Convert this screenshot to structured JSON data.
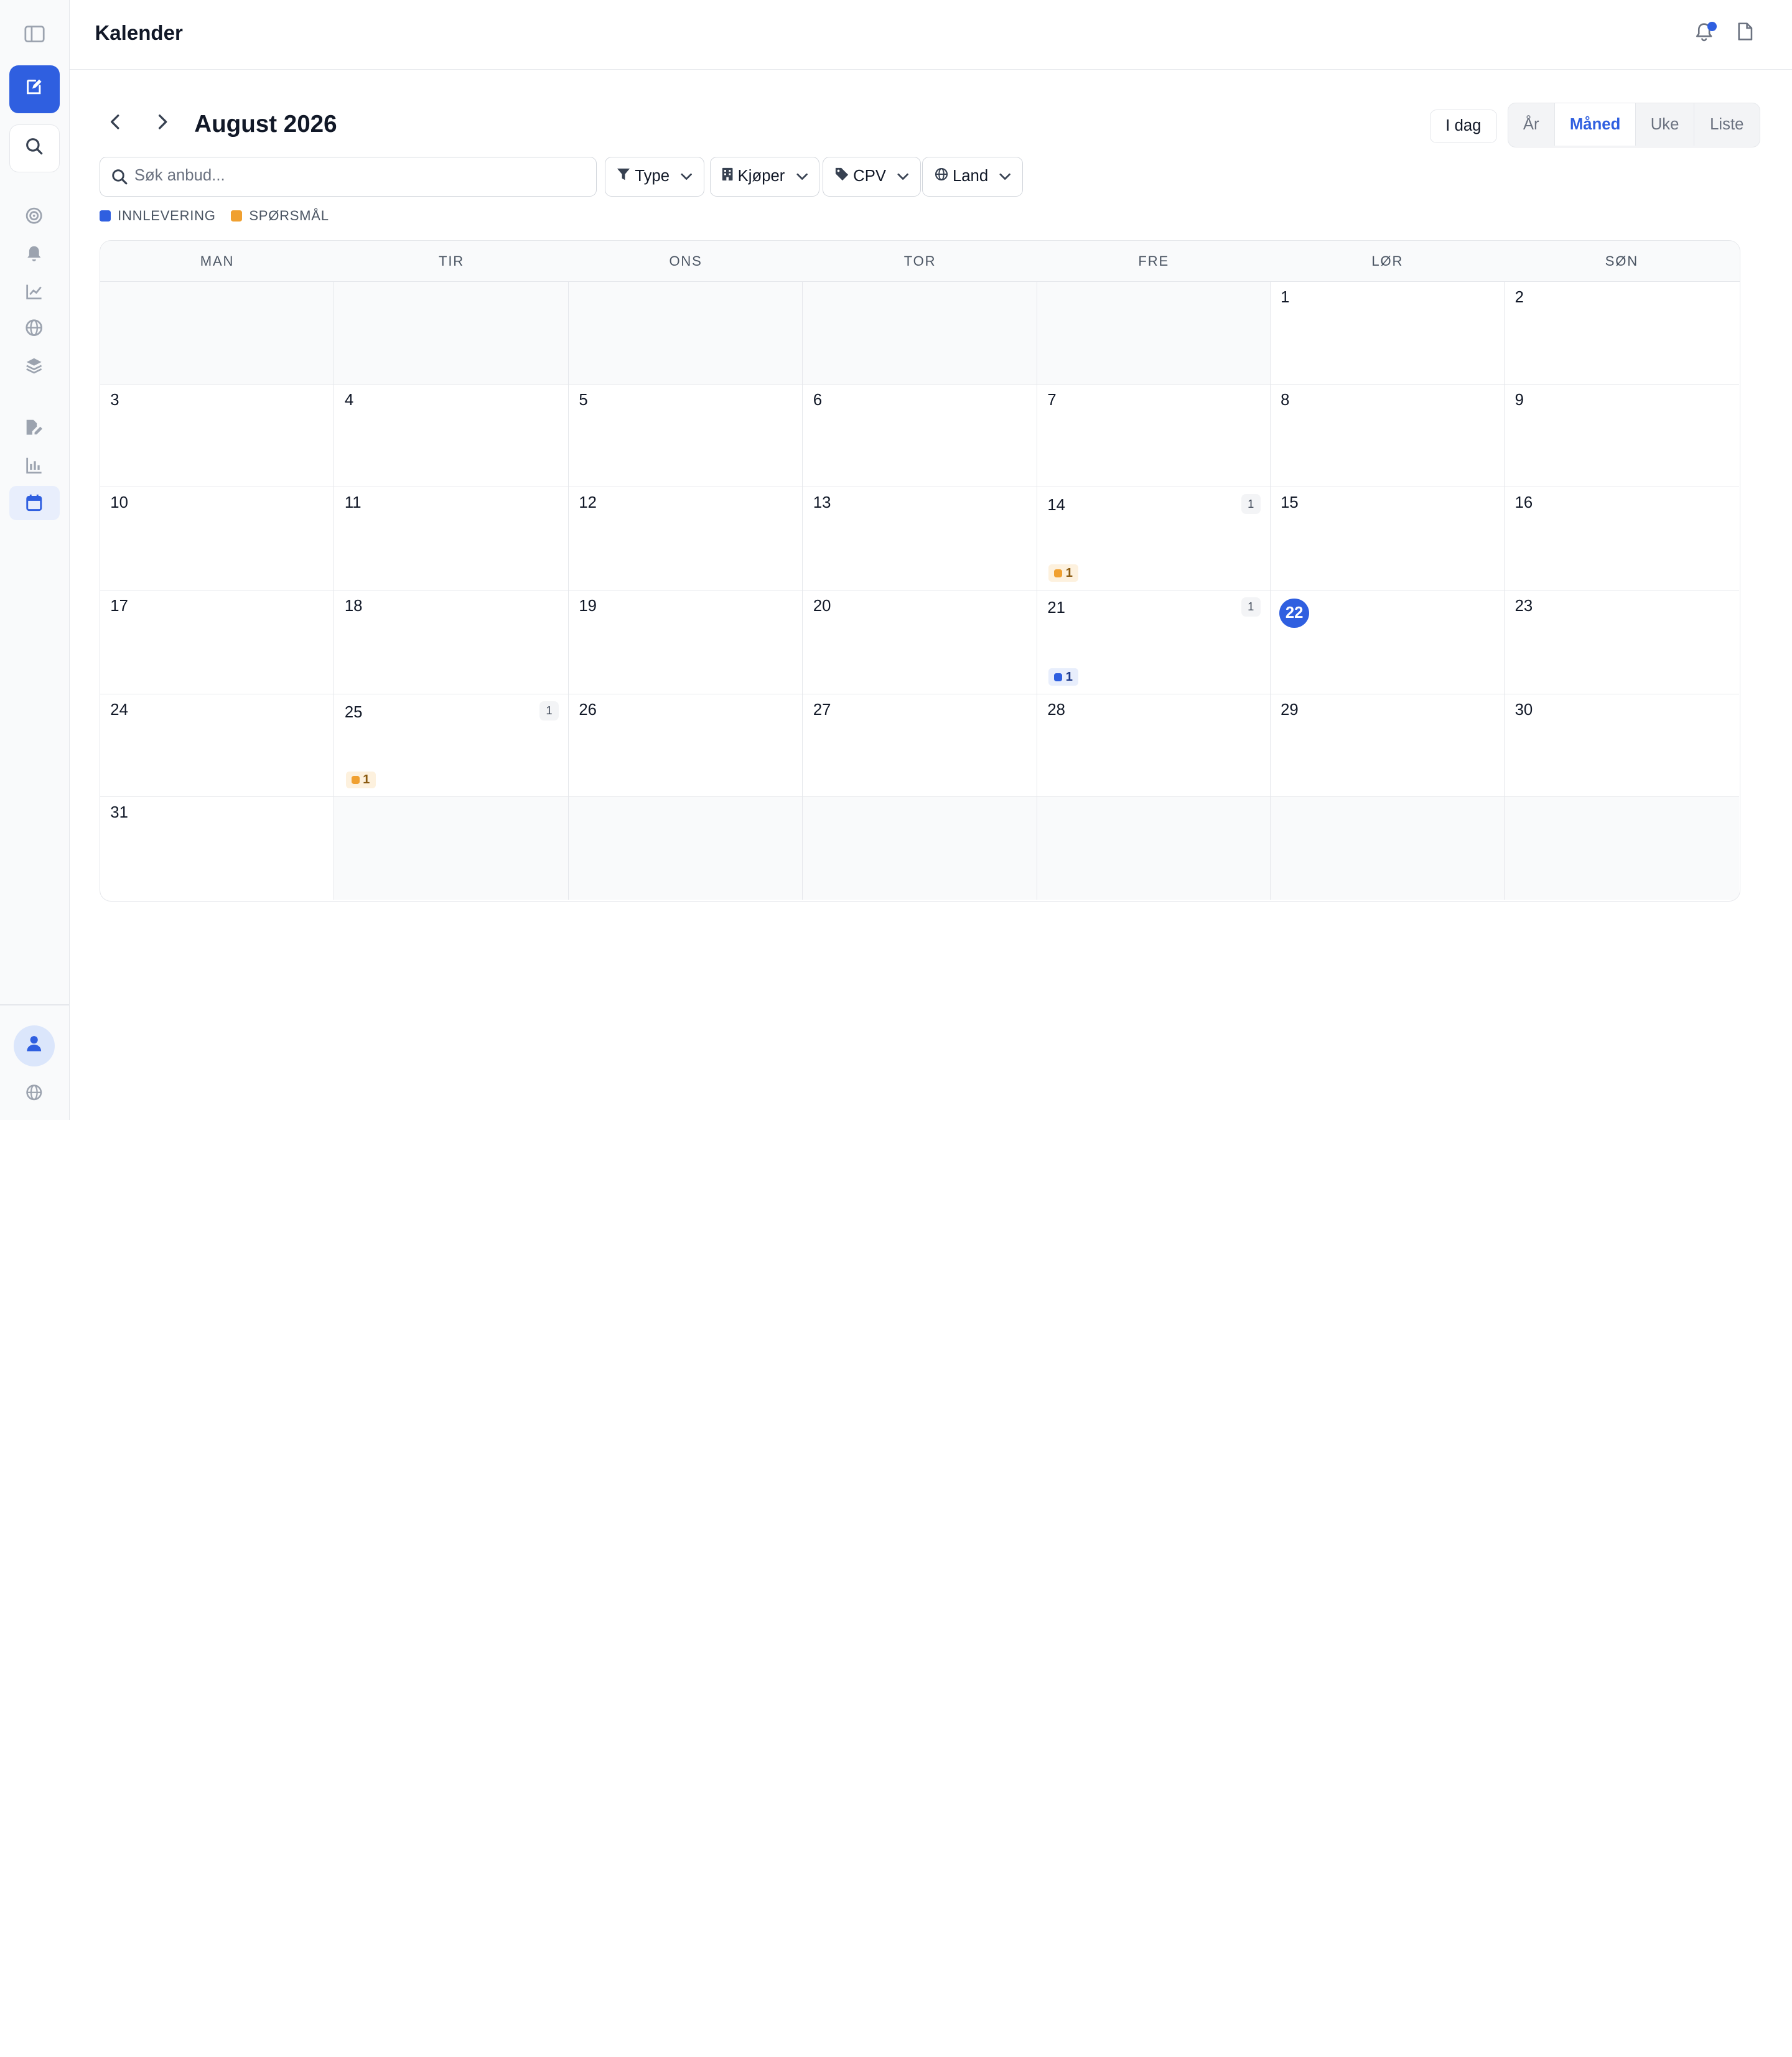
{
  "header": {
    "title": "Kalender"
  },
  "calendar_nav": {
    "month_title": "August 2026",
    "today_label": "I dag"
  },
  "views": [
    {
      "label": "År",
      "active": false
    },
    {
      "label": "Måned",
      "active": true
    },
    {
      "label": "Uke",
      "active": false
    },
    {
      "label": "Liste",
      "active": false
    }
  ],
  "search": {
    "placeholder": "Søk anbud...",
    "value": ""
  },
  "filters": [
    {
      "label": "Type",
      "icon": "funnel-icon"
    },
    {
      "label": "Kjøper",
      "icon": "building-icon"
    },
    {
      "label": "CPV",
      "icon": "tag-icon"
    },
    {
      "label": "Land",
      "icon": "globe-icon"
    }
  ],
  "legend": [
    {
      "label": "INNLEVERING",
      "color": "#2f5fe0"
    },
    {
      "label": "SPØRSMÅL",
      "color": "#f0a030"
    }
  ],
  "weekdays": [
    "MAN",
    "TIR",
    "ONS",
    "TOR",
    "FRE",
    "LØR",
    "SØN"
  ],
  "days": [
    {
      "d": ""
    },
    {
      "d": ""
    },
    {
      "d": ""
    },
    {
      "d": ""
    },
    {
      "d": ""
    },
    {
      "d": "1"
    },
    {
      "d": "2"
    },
    {
      "d": "3"
    },
    {
      "d": "4"
    },
    {
      "d": "5"
    },
    {
      "d": "6"
    },
    {
      "d": "7"
    },
    {
      "d": "8"
    },
    {
      "d": "9"
    },
    {
      "d": "10"
    },
    {
      "d": "11"
    },
    {
      "d": "12"
    },
    {
      "d": "13"
    },
    {
      "d": "14",
      "count": "1",
      "chip": "1",
      "chip_type": "question"
    },
    {
      "d": "15"
    },
    {
      "d": "16"
    },
    {
      "d": "17"
    },
    {
      "d": "18"
    },
    {
      "d": "19"
    },
    {
      "d": "20"
    },
    {
      "d": "21",
      "count": "1",
      "chip": "1",
      "chip_type": "submission"
    },
    {
      "d": "22",
      "today": true
    },
    {
      "d": "23"
    },
    {
      "d": "24"
    },
    {
      "d": "25",
      "count": "1",
      "chip": "1",
      "chip_type": "question"
    },
    {
      "d": "26"
    },
    {
      "d": "27"
    },
    {
      "d": "28"
    },
    {
      "d": "29"
    },
    {
      "d": "30"
    },
    {
      "d": "31"
    },
    {
      "d": ""
    },
    {
      "d": ""
    },
    {
      "d": ""
    },
    {
      "d": ""
    },
    {
      "d": ""
    },
    {
      "d": ""
    }
  ],
  "colors": {
    "accent": "#2f5fe0",
    "submission": "#2f5fe0",
    "question": "#f0a030",
    "submission_bg": "#e8eefc",
    "question_bg": "#fdf1de"
  },
  "sidebar": {
    "top_buttons": [
      "sidebar-toggle-icon",
      "edit-icon",
      "search-icon"
    ],
    "nav_icons": [
      "target-icon",
      "bell-icon",
      "trend-chart-icon",
      "globe-icon",
      "layers-icon",
      "document-edit-icon",
      "bar-chart-icon",
      "calendar-icon"
    ],
    "active": "calendar-icon"
  }
}
